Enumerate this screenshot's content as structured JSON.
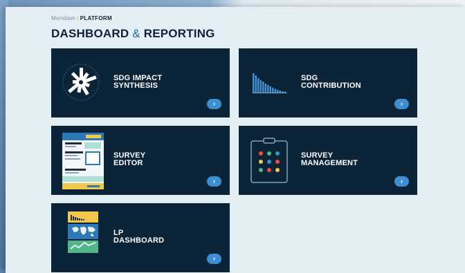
{
  "header": {
    "brand_name": "Meridiam",
    "brand_separator": "|",
    "brand_product": "PLATFORM",
    "title_part1": "DASHBOARD",
    "title_amp": "&",
    "title_part2": "REPORTING"
  },
  "colors": {
    "tile_bg": "#0c2438",
    "panel_bg": "#e4eef5",
    "accent": "#3d8fd1",
    "title": "#0d2235"
  },
  "tiles": [
    {
      "label": "SDG IMPACT\nSYNTHESIS",
      "icon": "radial-chart-icon",
      "arrow": "›"
    },
    {
      "label": "SDG\nCONTRIBUTION",
      "icon": "bar-chart-icon",
      "arrow": "›"
    },
    {
      "label": "SURVEY\nEDITOR",
      "icon": "survey-form-icon",
      "arrow": "›"
    },
    {
      "label": "SURVEY\nMANAGEMENT",
      "icon": "clipboard-icon",
      "arrow": "›"
    },
    {
      "label": "LP\nDASHBOARD",
      "icon": "dashboard-map-icon",
      "arrow": "›"
    }
  ]
}
